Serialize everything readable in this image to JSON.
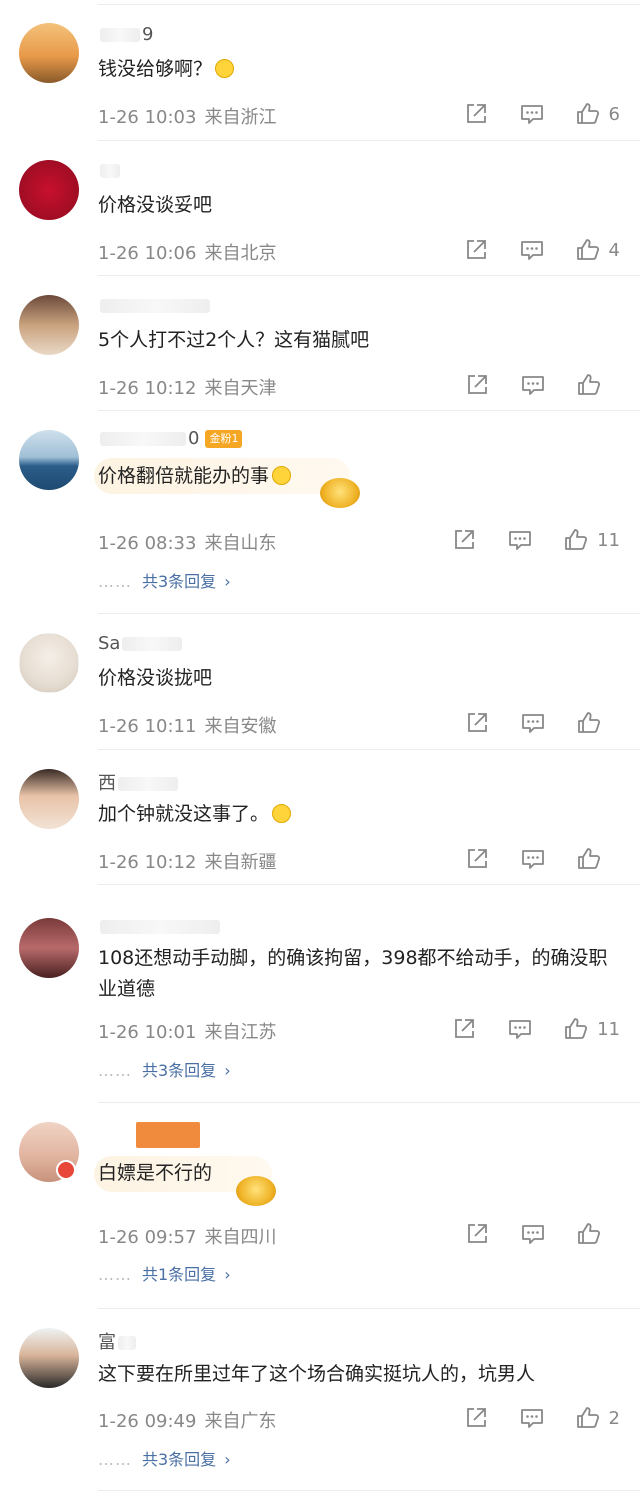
{
  "colors": {
    "accent_blue": "#4a6fa5",
    "meta_gray": "#888888",
    "badge_orange": "#f5a623"
  },
  "comments": [
    {
      "user": "9",
      "text": "钱没给够啊？",
      "date": "1-26 10:03",
      "location": "来自浙江",
      "likes": "6",
      "replies": ""
    },
    {
      "user": "",
      "text": "价格没谈妥吧",
      "date": "1-26 10:06",
      "location": "来自北京",
      "likes": "4",
      "replies": ""
    },
    {
      "user": "",
      "text": "5个人打不过2个人？这有猫腻吧",
      "date": "1-26 10:12",
      "location": "来自天津",
      "likes": "",
      "replies": ""
    },
    {
      "user": "0",
      "badge": "金粉1",
      "text": "价格翻倍就能办的事",
      "date": "1-26 08:33",
      "location": "来自山东",
      "likes": "11",
      "replies": "共3条回复"
    },
    {
      "user": "Sa",
      "text": "价格没谈拢吧",
      "date": "1-26 10:11",
      "location": "来自安徽",
      "likes": "",
      "replies": ""
    },
    {
      "user": "西",
      "text": "加个钟就没这事了。",
      "date": "1-26 10:12",
      "location": "来自新疆",
      "likes": "",
      "replies": ""
    },
    {
      "user": "",
      "text": "108还想动手动脚，的确该拘留，398都不给动手，的确没职业道德",
      "date": "1-26 10:01",
      "location": "来自江苏",
      "likes": "11",
      "replies": "共3条回复"
    },
    {
      "user": "",
      "text": "白嫖是不行的",
      "date": "1-26 09:57",
      "location": "来自四川",
      "likes": "",
      "replies": "共1条回复"
    },
    {
      "user": "富",
      "text": "这下要在所里过年了这个场合确实挺坑人的，坑男人",
      "date": "1-26 09:49",
      "location": "来自广东",
      "likes": "2",
      "replies": "共3条回复"
    }
  ],
  "icons": {
    "share": "share-icon",
    "comment": "comment-icon",
    "like": "like-icon",
    "chevron": "chevron-right-icon"
  },
  "glyphs": {
    "chevron": "›",
    "dots": "……"
  }
}
